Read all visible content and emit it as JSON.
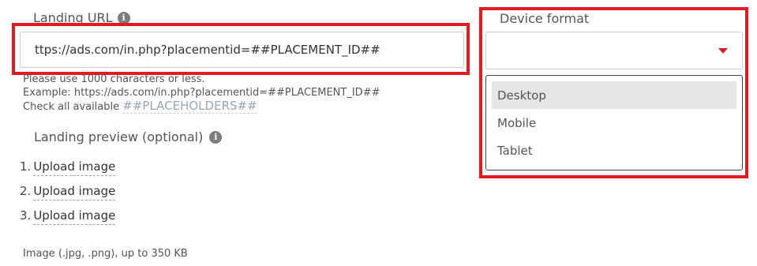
{
  "landing_url": {
    "label": "Landing URL",
    "value": "ttps://ads.com/in.php?placementid=##PLACEMENT_ID##",
    "help_limit": "Please use 1000 characters or less.",
    "help_example": "Example: https://ads.com/in.php?placementid=##PLACEMENT_ID##",
    "help_check_prefix": "Check all available",
    "placeholders_link": "##PLACEHOLDERS##"
  },
  "landing_preview": {
    "label": "Landing preview (optional)",
    "uploads": [
      {
        "number": "1.",
        "label": "Upload image"
      },
      {
        "number": "2.",
        "label": "Upload image"
      },
      {
        "number": "3.",
        "label": "Upload image"
      }
    ],
    "note": "Image (.jpg, .png), up to 350 KB"
  },
  "device_format": {
    "label": "Device format",
    "selected_value": "",
    "options": [
      "Desktop",
      "Mobile",
      "Tablet"
    ],
    "highlighted_option": "Desktop"
  },
  "colors": {
    "highlight_border": "#e21b23",
    "caret": "#d0202b",
    "option_highlight": "#e6e6e6"
  },
  "icons": {
    "info": "info-icon",
    "caret": "caret-down-icon"
  }
}
